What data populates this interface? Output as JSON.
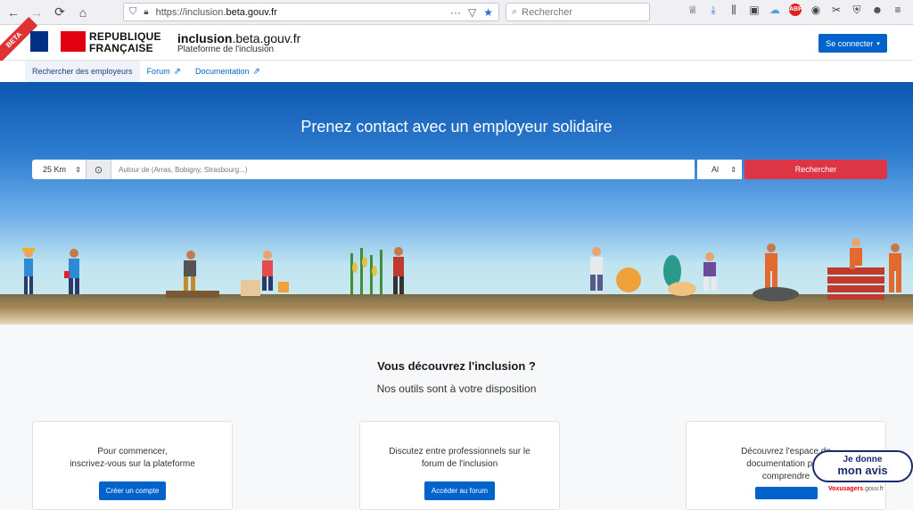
{
  "browser": {
    "url_prefix": "https://inclusion.",
    "url_domain": "beta.gouv.fr",
    "search_placeholder": "Rechercher"
  },
  "header": {
    "beta_label": "BETA",
    "rf_line1": "REPUBLIQUE",
    "rf_line2": "FRANÇAISE",
    "site_name_bold": "inclusion",
    "site_name_rest": ".beta.gouv.fr",
    "site_subtitle": "Plateforme de l'inclusion",
    "login_label": "Se connecter"
  },
  "tabs": [
    {
      "label": "Rechercher des employeurs"
    },
    {
      "label": "Forum"
    },
    {
      "label": "Documentation"
    }
  ],
  "hero": {
    "title": "Prenez contact avec un employeur solidaire",
    "radius_value": "25 Km",
    "city_placeholder": "Autour de (Arras, Bobigny, Strasbourg...)",
    "dept_value": "Al",
    "search_label": "Rechercher"
  },
  "discover": {
    "title": "Vous découvrez l'inclusion ?",
    "subtitle": "Nos outils sont à votre disposition"
  },
  "cards": [
    {
      "line1": "Pour commencer,",
      "line2": "inscrivez-vous sur la plateforme",
      "button": "Créer un compte"
    },
    {
      "line1": "Discutez entre professionnels sur le",
      "line2": "forum de l'inclusion",
      "button": "Accéder au forum"
    },
    {
      "line1": "Découvrez l'espace de",
      "line2": "documentation pour",
      "line3": "comprendre"
    }
  ],
  "vox": {
    "line1": "Je donne",
    "line2": "mon avis",
    "foot_brand": "Voxusagers",
    "foot_domain": ".gouv.fr"
  },
  "colors": {
    "primary": "#0063cb",
    "danger": "#dc3545",
    "marianne_blue": "#002f86",
    "marianne_red": "#e1000f"
  }
}
